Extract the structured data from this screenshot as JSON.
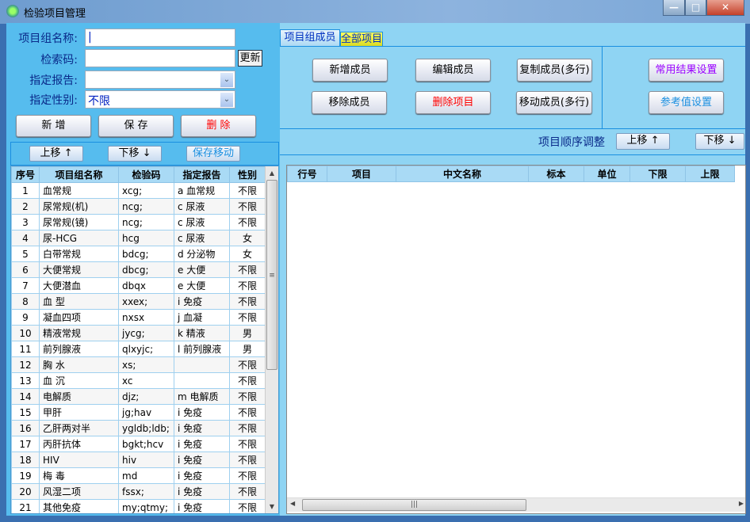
{
  "window": {
    "title": "检验项目管理",
    "minimize": "—",
    "maximize": "□",
    "close": "✕"
  },
  "form": {
    "group_name_label": "项目组名称:",
    "group_name_value": "|",
    "search_code_label": "检索码:",
    "search_code_value": "",
    "refresh_button": "更新",
    "report_label": "指定报告:",
    "report_value": "",
    "gender_label": "指定性别:",
    "gender_value": "不限"
  },
  "actions": {
    "add": "新 增",
    "save": "保 存",
    "delete": "删 除"
  },
  "move": {
    "up": "上移 ↑",
    "down": "下移 ↓",
    "save_move": "保存移动"
  },
  "group_table": {
    "columns": [
      "序号",
      "项目组名称",
      "检验码",
      "指定报告",
      "性别"
    ],
    "rows": [
      [
        "1",
        "血常规",
        "xcg;",
        "a 血常规",
        "不限"
      ],
      [
        "2",
        "尿常规(机)",
        "ncg;",
        "c 尿液",
        "不限"
      ],
      [
        "3",
        "尿常规(镜)",
        "ncg;",
        "c 尿液",
        "不限"
      ],
      [
        "4",
        "尿-HCG",
        "hcg",
        "c 尿液",
        "女"
      ],
      [
        "5",
        "白带常规",
        "bdcg;",
        "d 分泌物",
        "女"
      ],
      [
        "6",
        "大便常规",
        "dbcg;",
        "e 大便",
        "不限"
      ],
      [
        "7",
        "大便潜血",
        "dbqx",
        "e 大便",
        "不限"
      ],
      [
        "8",
        "血 型",
        "xxex;",
        "i 免疫",
        "不限"
      ],
      [
        "9",
        "凝血四项",
        "nxsx",
        "j 血凝",
        "不限"
      ],
      [
        "10",
        "精液常规",
        "jycg;",
        "k 精液",
        "男"
      ],
      [
        "11",
        "前列腺液",
        "qlxyjc;",
        "l 前列腺液",
        "男"
      ],
      [
        "12",
        "胸 水",
        "xs;",
        "",
        "不限"
      ],
      [
        "13",
        "血 沉",
        "xc",
        "",
        "不限"
      ],
      [
        "14",
        "电解质",
        "djz;",
        "m 电解质",
        "不限"
      ],
      [
        "15",
        "甲肝",
        "jg;hav",
        "i 免疫",
        "不限"
      ],
      [
        "16",
        "乙肝两对半",
        "ygldb;ldb;",
        "i 免疫",
        "不限"
      ],
      [
        "17",
        "丙肝抗体",
        "bgkt;hcv",
        "i 免疫",
        "不限"
      ],
      [
        "18",
        "HIV",
        "hiv",
        "i 免疫",
        "不限"
      ],
      [
        "19",
        "梅 毒",
        "md",
        "i 免疫",
        "不限"
      ],
      [
        "20",
        "风湿二项",
        "fssx;",
        "i 免疫",
        "不限"
      ],
      [
        "21",
        "其他免疫",
        "my;qtmy;",
        "i 免疫",
        "不限"
      ]
    ]
  },
  "tabs": [
    {
      "label": "项目组成员",
      "active": true
    },
    {
      "label": "全部项目",
      "active": false
    }
  ],
  "member_buttons": {
    "add": "新增成员",
    "edit": "编辑成员",
    "copy": "复制成员(多行)",
    "remove": "移除成员",
    "delete_item": "删除项目",
    "move": "移动成员(多行)",
    "common_result": "常用结果设置",
    "reference": "参考值设置"
  },
  "order": {
    "label": "项目顺序调整",
    "up": "上移 ↑",
    "down": "下移 ↓"
  },
  "member_table": {
    "columns": [
      "行号",
      "项目",
      "中文名称",
      "标本",
      "单位",
      "下限",
      "上限"
    ],
    "rows": []
  },
  "colors": {
    "left_panel": "#56bcee",
    "right_panel": "#8fd4f3",
    "delete": "#ff0000",
    "common_result": "#9900ff",
    "reference": "#1a8fe0",
    "tab_all": "#f0f020"
  }
}
